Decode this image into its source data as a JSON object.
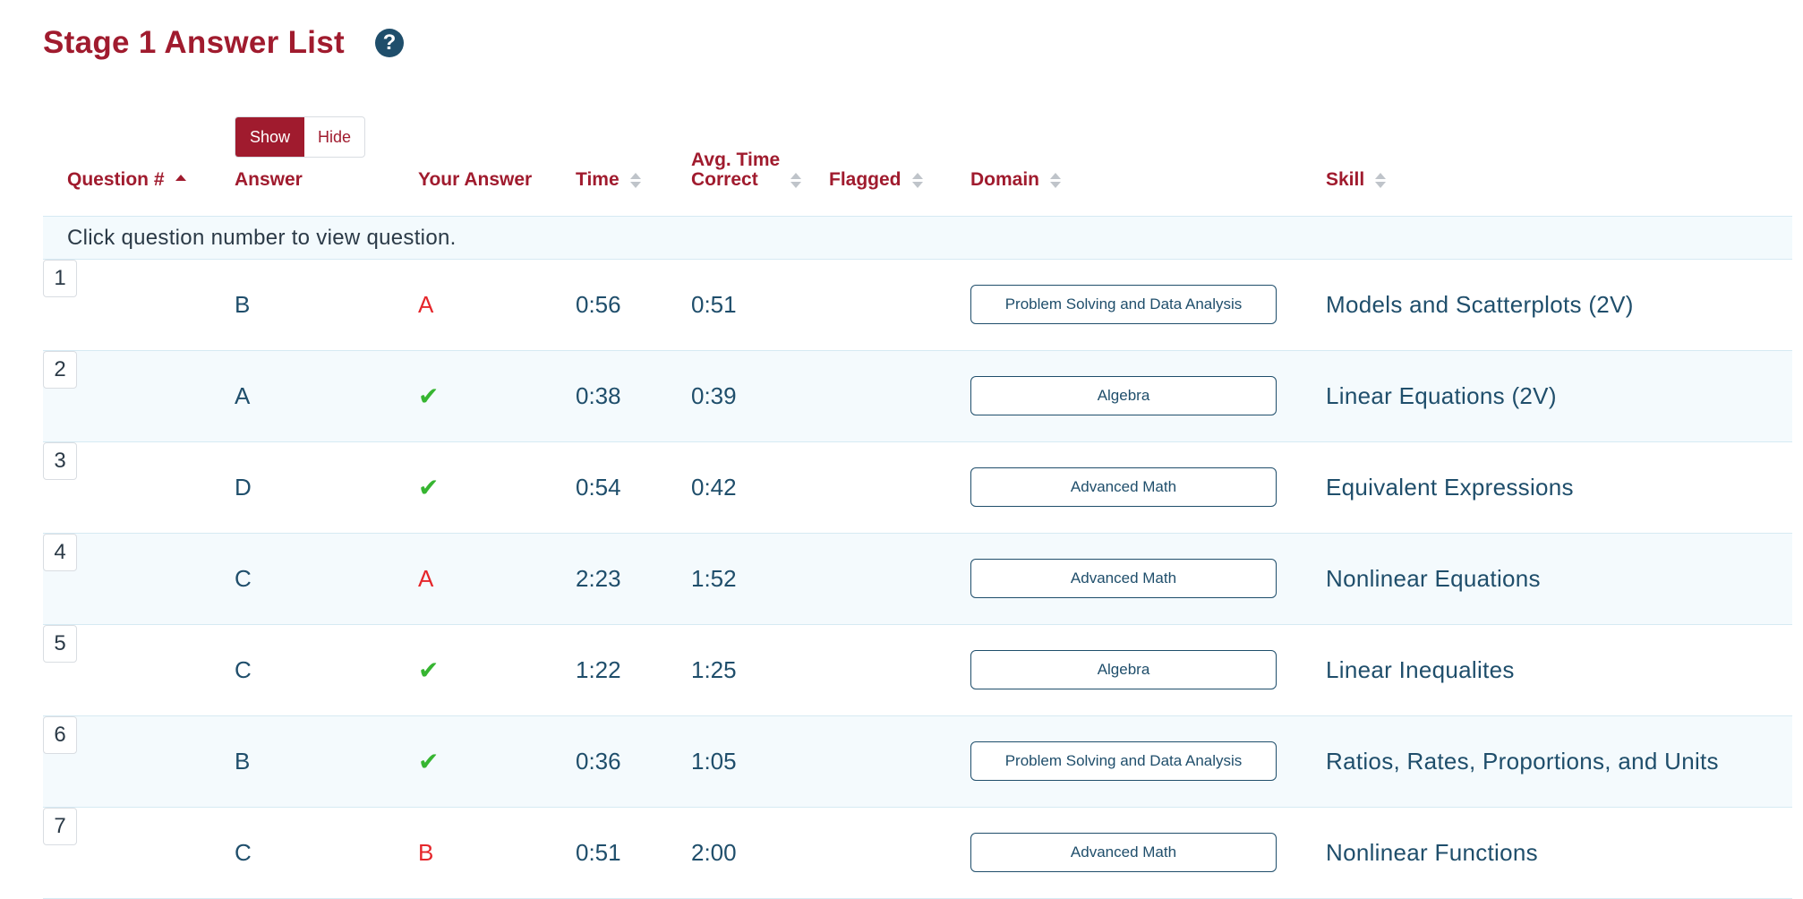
{
  "page": {
    "title": "Stage 1 Answer List",
    "help_icon": "question-circle-icon"
  },
  "toggle": {
    "show_label": "Show",
    "hide_label": "Hide",
    "selected": "Show"
  },
  "columns": {
    "question": "Question #",
    "answer": "Answer",
    "your_answer": "Your Answer",
    "time": "Time",
    "avg_line1": "Avg. Time",
    "avg_line2": "Correct",
    "flagged": "Flagged",
    "domain": "Domain",
    "skill": "Skill"
  },
  "info": "Click question number to view question.",
  "colors": {
    "brand": "#a01b2e",
    "text": "#1f4e6b",
    "correct": "#36b531",
    "wrong": "#e5262b"
  },
  "rows": [
    {
      "num": "1",
      "answer": "B",
      "your_answer": "A",
      "correct": false,
      "time": "0:56",
      "avg": "0:51",
      "domain": "Problem Solving and Data Analysis",
      "skill": "Models and Scatterplots (2V)"
    },
    {
      "num": "2",
      "answer": "A",
      "your_answer": "✔",
      "correct": true,
      "time": "0:38",
      "avg": "0:39",
      "domain": "Algebra",
      "skill": "Linear Equations (2V)"
    },
    {
      "num": "3",
      "answer": "D",
      "your_answer": "✔",
      "correct": true,
      "time": "0:54",
      "avg": "0:42",
      "domain": "Advanced Math",
      "skill": "Equivalent Expressions"
    },
    {
      "num": "4",
      "answer": "C",
      "your_answer": "A",
      "correct": false,
      "time": "2:23",
      "avg": "1:52",
      "domain": "Advanced Math",
      "skill": "Nonlinear Equations"
    },
    {
      "num": "5",
      "answer": "C",
      "your_answer": "✔",
      "correct": true,
      "time": "1:22",
      "avg": "1:25",
      "domain": "Algebra",
      "skill": "Linear Inequalites"
    },
    {
      "num": "6",
      "answer": "B",
      "your_answer": "✔",
      "correct": true,
      "time": "0:36",
      "avg": "1:05",
      "domain": "Problem Solving and Data Analysis",
      "skill": "Ratios, Rates, Proportions, and Units"
    },
    {
      "num": "7",
      "answer": "C",
      "your_answer": "B",
      "correct": false,
      "time": "0:51",
      "avg": "2:00",
      "domain": "Advanced Math",
      "skill": "Nonlinear Functions"
    }
  ]
}
